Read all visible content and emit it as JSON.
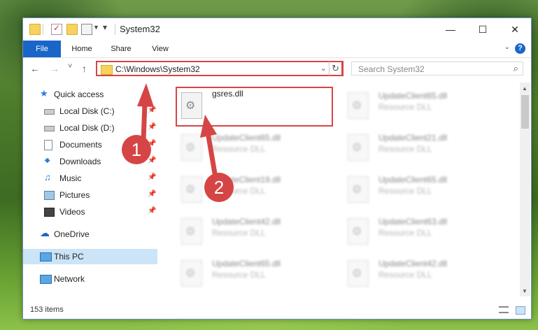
{
  "window": {
    "title": "System32",
    "controls": {
      "minimize": "—",
      "maximize": "☐",
      "close": "✕"
    }
  },
  "ribbon": {
    "tabs": [
      "File",
      "Home",
      "Share",
      "View"
    ],
    "help": "?"
  },
  "navigation": {
    "back": "←",
    "forward": "→",
    "recent": "˅",
    "up": "↑",
    "address": "C:\\Windows\\System32",
    "address_dropdown": "⌄",
    "refresh": "↻",
    "search_placeholder": "Search System32",
    "search_icon": "⌕"
  },
  "sidebar": {
    "items": [
      {
        "label": "Quick access",
        "icon": "star-icon"
      },
      {
        "label": "Local Disk (C:)",
        "icon": "drive-icon",
        "pinned": true
      },
      {
        "label": "Local Disk (D:)",
        "icon": "drive-icon",
        "pinned": true
      },
      {
        "label": "Documents",
        "icon": "document-icon",
        "pinned": true
      },
      {
        "label": "Downloads",
        "icon": "download-icon",
        "pinned": true
      },
      {
        "label": "Music",
        "icon": "music-icon",
        "pinned": true
      },
      {
        "label": "Pictures",
        "icon": "pictures-icon",
        "pinned": true
      },
      {
        "label": "Videos",
        "icon": "video-icon",
        "pinned": true
      },
      {
        "label": "OneDrive",
        "icon": "cloud-icon"
      },
      {
        "label": "This PC",
        "icon": "computer-icon",
        "selected": true
      },
      {
        "label": "Network",
        "icon": "network-icon"
      }
    ]
  },
  "files": {
    "primary": {
      "name": "gsres.dll",
      "type": ""
    },
    "items": [
      {
        "name": "UpdateClient65.dll",
        "type": "Resource DLL"
      },
      {
        "name": "UpdateClient65.dll",
        "type": "Resource DLL"
      },
      {
        "name": "UpdateClient21.dll",
        "type": "Resource DLL"
      },
      {
        "name": "UpdateClient19.dll",
        "type": "Resource DLL"
      },
      {
        "name": "UpdateClient65.dll",
        "type": "Resource DLL"
      },
      {
        "name": "UpdateClient42.dll",
        "type": "Resource DLL"
      },
      {
        "name": "UpdateClient63.dll",
        "type": "Resource DLL"
      },
      {
        "name": "UpdateClient65.dll",
        "type": "Resource DLL"
      },
      {
        "name": "UpdateClient42.dll",
        "type": "Resource DLL"
      }
    ]
  },
  "status": {
    "count": "153 items"
  },
  "annotations": {
    "one": "1",
    "two": "2",
    "color": "#d64545"
  }
}
